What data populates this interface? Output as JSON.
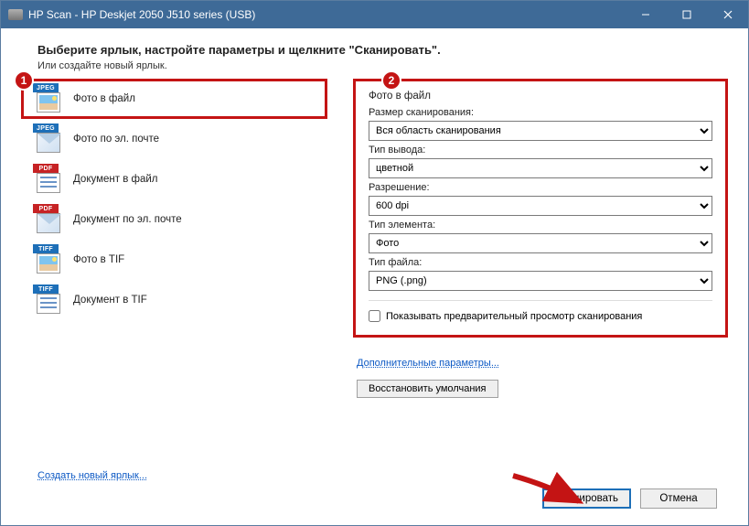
{
  "window": {
    "title": "HP Scan - HP Deskjet 2050 J510 series (USB)"
  },
  "heading": "Выберите ярлык, настройте параметры и щелкните \"Сканировать\".",
  "subtext": "Или создайте новый ярлык.",
  "shortcuts": [
    {
      "label": "Фото в файл",
      "badge": "JPEG",
      "thumb": "photo",
      "active": true
    },
    {
      "label": "Фото по эл. почте",
      "badge": "JPEG",
      "thumb": "env"
    },
    {
      "label": "Документ в файл",
      "badge": "PDF",
      "thumb": "doc"
    },
    {
      "label": "Документ по эл. почте",
      "badge": "PDF",
      "thumb": "env"
    },
    {
      "label": "Фото в TIF",
      "badge": "TIFF",
      "thumb": "photo"
    },
    {
      "label": "Документ в TIF",
      "badge": "TIFF",
      "thumb": "doc"
    }
  ],
  "form": {
    "title": "Фото в файл",
    "scan_size": {
      "label": "Размер сканирования:",
      "value": "Вся область сканирования"
    },
    "output_type": {
      "label": "Тип вывода:",
      "value": "цветной"
    },
    "resolution": {
      "label": "Разрешение:",
      "value": "600 dpi"
    },
    "item_type": {
      "label": "Тип элемента:",
      "value": "Фото"
    },
    "file_type": {
      "label": "Тип файла:",
      "value": "PNG (.png)"
    },
    "preview": {
      "label": "Показывать предварительный просмотр сканирования",
      "checked": false
    }
  },
  "links": {
    "advanced": "Дополнительные параметры...",
    "restore": "Восстановить умолчания",
    "new_shortcut": "Создать новый ярлык..."
  },
  "buttons": {
    "scan": "Сканировать",
    "cancel": "Отмена"
  },
  "annotations": {
    "circle1": "1",
    "circle2": "2"
  }
}
